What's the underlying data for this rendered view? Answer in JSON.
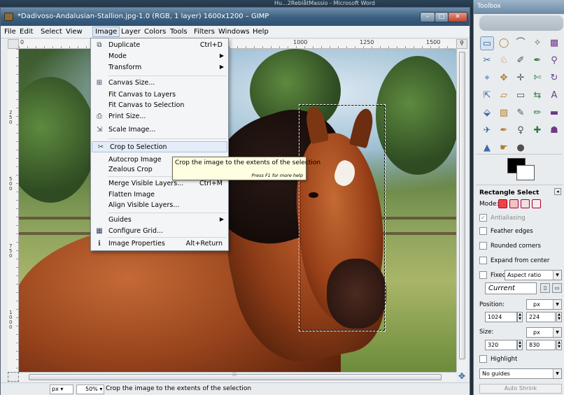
{
  "background_window": {
    "title": "Hu...2ReblåtMassio - Microsoft Word"
  },
  "main_window": {
    "title": "*Dadivoso-Andalusian-Stallion.jpg-1.0 (RGB, 1 layer) 1600x1200 – GIMP",
    "buttons": {
      "minimize": "–",
      "maximize": "□",
      "close": "✕"
    }
  },
  "menubar": [
    "File",
    "Edit",
    "Select",
    "View",
    "Image",
    "Layer",
    "Colors",
    "Tools",
    "Filters",
    "Windows",
    "Help"
  ],
  "ruler": {
    "h_ticks": [
      "0",
      "1000",
      "1250",
      "1500"
    ],
    "v_ticks": [
      "250",
      "500",
      "750",
      "1000"
    ]
  },
  "image_menu": {
    "items": [
      {
        "label": "Duplicate",
        "shortcut": "Ctrl+D",
        "icon": "duplicate-icon",
        "glyph": "⧉"
      },
      {
        "label": "Mode",
        "submenu": true
      },
      {
        "label": "Transform",
        "submenu": true
      },
      {
        "label": "Canvas Size...",
        "icon": "canvas-size-icon",
        "glyph": "⊞"
      },
      {
        "label": "Fit Canvas to Layers"
      },
      {
        "label": "Fit Canvas to Selection"
      },
      {
        "label": "Print Size...",
        "icon": "print-size-icon",
        "glyph": "⎙"
      },
      {
        "label": "Scale Image...",
        "icon": "scale-image-icon",
        "glyph": "⇲"
      },
      {
        "label": "Crop to Selection",
        "icon": "crop-icon",
        "glyph": "✂",
        "highlighted": true
      },
      {
        "label": "Autocrop Image"
      },
      {
        "label": "Zealous Crop"
      },
      {
        "label": "Merge Visible Layers...",
        "shortcut": "Ctrl+M"
      },
      {
        "label": "Flatten Image"
      },
      {
        "label": "Align Visible Layers..."
      },
      {
        "label": "Guides",
        "submenu": true
      },
      {
        "label": "Configure Grid...",
        "icon": "grid-icon",
        "glyph": "▦"
      },
      {
        "label": "Image Properties",
        "shortcut": "Alt+Return",
        "icon": "info-icon",
        "glyph": "ℹ"
      }
    ],
    "tooltip": {
      "text": "Crop the image to the extents of the selection",
      "hint": "Press F1 for more help"
    }
  },
  "statusbar": {
    "unit": "px",
    "zoom": "50%",
    "message": "Crop the image to the extents of the selection"
  },
  "toolbox": {
    "title": "Toolbox",
    "tools": [
      {
        "name": "rect-select-icon",
        "glyph": "▭"
      },
      {
        "name": "ellipse-select-icon",
        "glyph": "◯"
      },
      {
        "name": "lasso-icon",
        "glyph": "⌒"
      },
      {
        "name": "fuzzy-select-icon",
        "glyph": "✧"
      },
      {
        "name": "color-select-icon",
        "glyph": "▩"
      },
      {
        "name": "scissors-icon",
        "glyph": "✂"
      },
      {
        "name": "foreground-select-icon",
        "glyph": "♘"
      },
      {
        "name": "paths-icon",
        "glyph": "✐"
      },
      {
        "name": "color-picker-icon",
        "glyph": "✒"
      },
      {
        "name": "zoom-icon",
        "glyph": "⚲"
      },
      {
        "name": "measure-icon",
        "glyph": "⌖"
      },
      {
        "name": "move-icon",
        "glyph": "✥"
      },
      {
        "name": "align-icon",
        "glyph": "✛"
      },
      {
        "name": "crop-tool-icon",
        "glyph": "✄"
      },
      {
        "name": "rotate-icon",
        "glyph": "↻"
      },
      {
        "name": "scale-icon",
        "glyph": "⇱"
      },
      {
        "name": "shear-icon",
        "glyph": "▱"
      },
      {
        "name": "perspective-icon",
        "glyph": "▭"
      },
      {
        "name": "flip-icon",
        "glyph": "⇆"
      },
      {
        "name": "text-icon",
        "glyph": "A"
      },
      {
        "name": "bucket-fill-icon",
        "glyph": "⬙"
      },
      {
        "name": "blend-icon",
        "glyph": "▧"
      },
      {
        "name": "pencil-icon",
        "glyph": "✎"
      },
      {
        "name": "paintbrush-icon",
        "glyph": "✏"
      },
      {
        "name": "eraser-icon",
        "glyph": "▬"
      },
      {
        "name": "airbrush-icon",
        "glyph": "✈"
      },
      {
        "name": "ink-icon",
        "glyph": "✒"
      },
      {
        "name": "clone-icon",
        "glyph": "♀"
      },
      {
        "name": "heal-icon",
        "glyph": "✚"
      },
      {
        "name": "perspective-clone-icon",
        "glyph": "☗"
      },
      {
        "name": "blur-icon",
        "glyph": "▲"
      },
      {
        "name": "smudge-icon",
        "glyph": "☛"
      },
      {
        "name": "dodge-burn-icon",
        "glyph": "●"
      }
    ],
    "options": {
      "title": "Rectangle Select",
      "mode_label": "Mode:",
      "antialiasing": "Antialiasing",
      "feather_edges": "Feather edges",
      "rounded_corners": "Rounded corners",
      "expand_from_center": "Expand from center",
      "fixed_label": "Fixed:",
      "fixed_value": "Aspect ratio",
      "current": "Current",
      "position_label": "Position:",
      "position_unit": "px",
      "position_x": "1024",
      "position_y": "224",
      "size_label": "Size:",
      "size_unit": "px",
      "size_w": "320",
      "size_h": "830",
      "highlight": "Highlight",
      "guides_value": "No guides",
      "auto_shrink": "Auto Shrink"
    }
  }
}
